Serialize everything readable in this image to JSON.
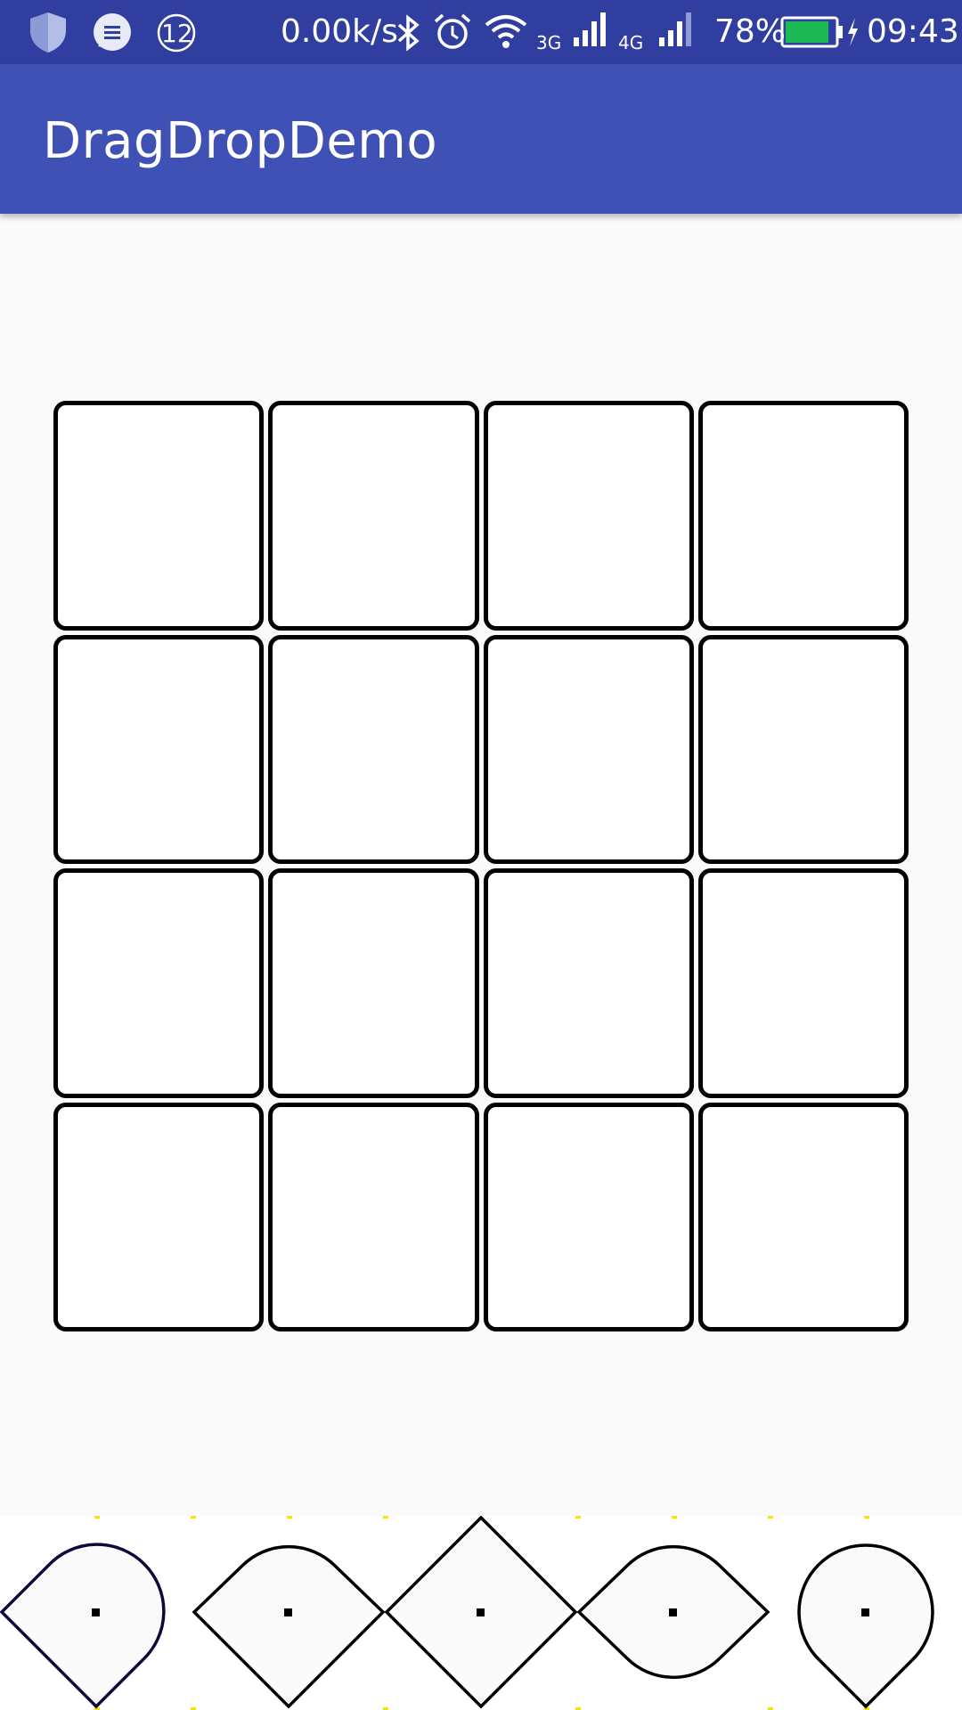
{
  "status_bar": {
    "notification_count": "12",
    "net_speed": "0.00k/s",
    "net_3g": "3G",
    "net_4g": "4G",
    "battery": "78%",
    "time": "09:43",
    "battery_color": "#1db954"
  },
  "app_bar": {
    "title": "DragDropDemo",
    "color": "#3f51b5"
  },
  "board": {
    "rows": 4,
    "columns": 4,
    "cells": [
      "",
      "",
      "",
      "",
      "",
      "",
      "",
      "",
      "",
      "",
      "",
      "",
      "",
      "",
      "",
      ""
    ]
  },
  "tray": {
    "pieces": [
      {
        "name": "piece-teardrop-top-right"
      },
      {
        "name": "piece-leaf-top"
      },
      {
        "name": "piece-diamond"
      },
      {
        "name": "piece-leaf-bottom"
      },
      {
        "name": "piece-teardrop-bottom"
      }
    ]
  }
}
